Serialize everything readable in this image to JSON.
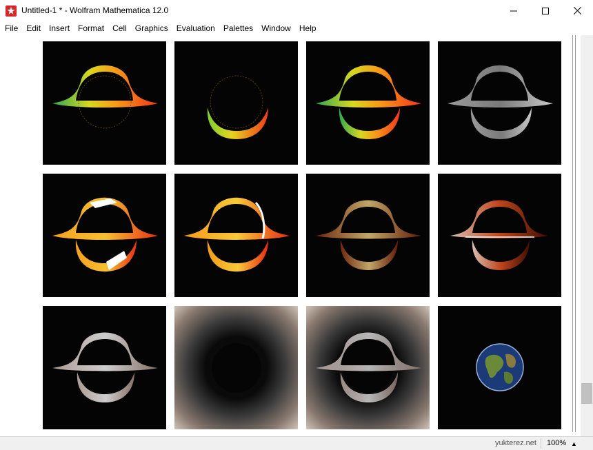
{
  "window": {
    "title": "Untitled-1 * - Wolfram Mathematica 12.0",
    "controls": [
      "minimize",
      "maximize",
      "close"
    ]
  },
  "menu": [
    "File",
    "Edit",
    "Insert",
    "Format",
    "Cell",
    "Graphics",
    "Evaluation",
    "Palettes",
    "Window",
    "Help"
  ],
  "tiles": [
    {
      "icon": "black-hole-accretion-disk-colored-top"
    },
    {
      "icon": "black-hole-accretion-disk-colored-bottom"
    },
    {
      "icon": "black-hole-accretion-disk-colored-full"
    },
    {
      "icon": "black-hole-accretion-disk-grayscale"
    },
    {
      "icon": "black-hole-accretion-disk-orange-striped"
    },
    {
      "icon": "black-hole-accretion-disk-orange"
    },
    {
      "icon": "black-hole-accretion-disk-glow"
    },
    {
      "icon": "black-hole-accretion-disk-bright-glow"
    },
    {
      "icon": "black-hole-accretion-disk-textured"
    },
    {
      "icon": "black-hole-lensed-background"
    },
    {
      "icon": "black-hole-lensed-background-with-disk"
    },
    {
      "icon": "earth-globe"
    }
  ],
  "status": {
    "watermark": "yukterez.net",
    "zoom": "100%"
  },
  "colors": {
    "titlebar_bg": "#ffffff",
    "tile_bg": "#040404",
    "app_icon_red": "#d6282b"
  }
}
